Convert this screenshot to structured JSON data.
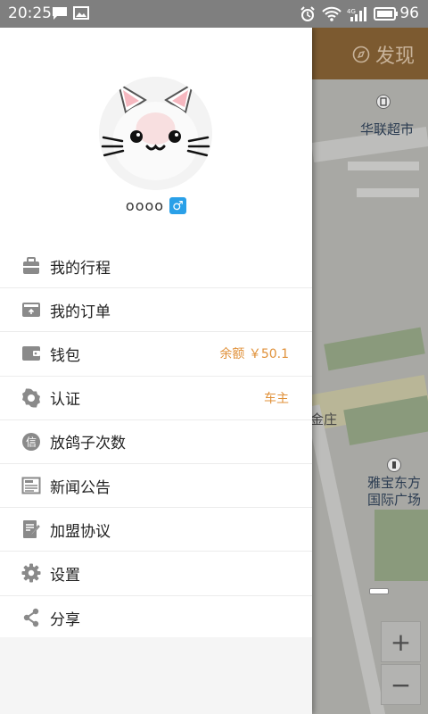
{
  "status_bar": {
    "time": "20:25",
    "battery": "96",
    "left_icons": [
      "message-icon",
      "image-icon"
    ],
    "right_icons": [
      "alarm-icon",
      "wifi-icon",
      "signal-4g-icon",
      "battery-icon"
    ]
  },
  "map": {
    "header_title": "发现",
    "labels": {
      "supermarket": "华联超市",
      "street": "金庄",
      "plaza_line1": "雅宝东方",
      "plaza_line2": "国际广场"
    },
    "zoom_in": "+",
    "zoom_out": "−"
  },
  "profile": {
    "username": "oooo",
    "gender_symbol": "♂"
  },
  "menu": {
    "items": [
      {
        "id": "trips",
        "icon": "briefcase-icon",
        "label": "我的行程",
        "extra": ""
      },
      {
        "id": "orders",
        "icon": "order-card-icon",
        "label": "我的订单",
        "extra": ""
      },
      {
        "id": "wallet",
        "icon": "wallet-icon",
        "label": "钱包",
        "extra": "余额 ￥50.1"
      },
      {
        "id": "verify",
        "icon": "badge-icon",
        "label": "认证",
        "extra": "车主"
      },
      {
        "id": "no-show",
        "icon": "credit-icon",
        "label": "放鸽子次数",
        "extra": ""
      },
      {
        "id": "news",
        "icon": "news-icon",
        "label": "新闻公告",
        "extra": ""
      },
      {
        "id": "agreement",
        "icon": "agreement-icon",
        "label": "加盟协议",
        "extra": ""
      },
      {
        "id": "settings",
        "icon": "gear-icon",
        "label": "设置",
        "extra": ""
      },
      {
        "id": "share",
        "icon": "share-icon",
        "label": "分享",
        "extra": ""
      }
    ]
  },
  "colors": {
    "accent_orange": "#e0913a",
    "gender_blue": "#2aa0e8",
    "status_bar": "#7f7f7f",
    "map_header": "#7c5a30"
  }
}
